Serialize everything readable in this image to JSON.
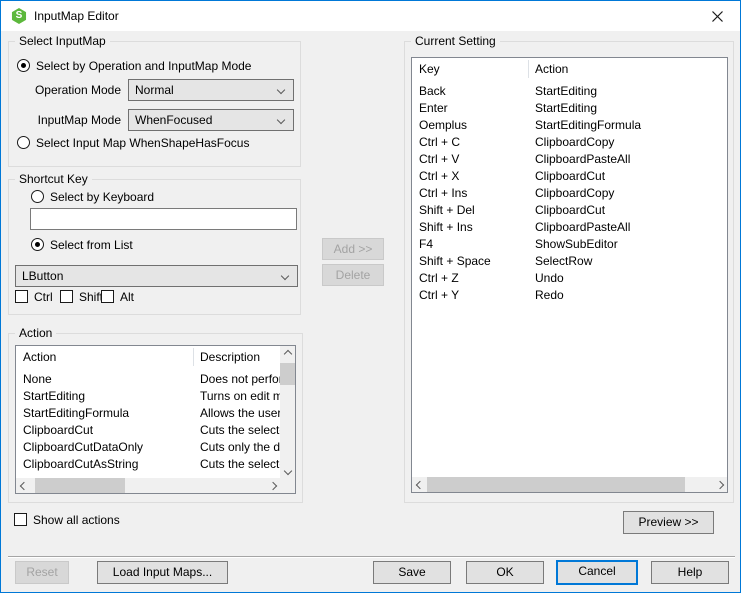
{
  "window": {
    "title": "InputMap Editor"
  },
  "colors": {
    "accent": "#0078d7",
    "icon_green": "#5cb83c",
    "disabled_text": "#a3a3a3"
  },
  "icons": {
    "app": "S"
  },
  "select_inputmap": {
    "title": "Select InputMap",
    "radio_operation_label": "Select by Operation and InputMap Mode",
    "radio_operation_selected": true,
    "operation_mode_label": "Operation Mode",
    "operation_mode_value": "Normal",
    "inputmap_mode_label": "InputMap Mode",
    "inputmap_mode_value": "WhenFocused",
    "radio_shape_label": "Select Input Map WhenShapeHasFocus",
    "radio_shape_selected": false
  },
  "shortcut_key": {
    "title": "Shortcut Key",
    "radio_keyboard_label": "Select by Keyboard",
    "keyboard_value": "",
    "radio_list_label": "Select from List",
    "radio_list_selected": true,
    "key_list_value": "LButton",
    "modifiers": [
      "Ctrl",
      "Shift",
      "Alt"
    ]
  },
  "action_list": {
    "title": "Action",
    "columns": [
      "Action",
      "Description"
    ],
    "rows": [
      [
        "None",
        "Does not perform"
      ],
      [
        "StartEditing",
        "Turns on edit mod"
      ],
      [
        "StartEditingFormula",
        "Allows the user to"
      ],
      [
        "ClipboardCut",
        "Cuts the selected"
      ],
      [
        "ClipboardCutDataOnly",
        "Cuts only the data"
      ],
      [
        "ClipboardCutAsString",
        "Cuts the selected"
      ]
    ]
  },
  "show_all_actions_label": "Show all actions",
  "middle_buttons": {
    "add": "Add >>",
    "delete": "Delete"
  },
  "current_setting": {
    "title": "Current Setting",
    "columns": [
      "Key",
      "Action"
    ],
    "rows": [
      [
        "Back",
        "StartEditing"
      ],
      [
        "Enter",
        "StartEditing"
      ],
      [
        "Oemplus",
        "StartEditingFormula"
      ],
      [
        "Ctrl + C",
        "ClipboardCopy"
      ],
      [
        "Ctrl + V",
        "ClipboardPasteAll"
      ],
      [
        "Ctrl + X",
        "ClipboardCut"
      ],
      [
        "Ctrl + Ins",
        "ClipboardCopy"
      ],
      [
        "Shift + Del",
        "ClipboardCut"
      ],
      [
        "Shift + Ins",
        "ClipboardPasteAll"
      ],
      [
        "F4",
        "ShowSubEditor"
      ],
      [
        "Shift + Space",
        "SelectRow"
      ],
      [
        "Ctrl + Z",
        "Undo"
      ],
      [
        "Ctrl + Y",
        "Redo"
      ]
    ]
  },
  "preview_button_label": "Preview >>",
  "bottom_buttons": {
    "reset": "Reset",
    "load": "Load Input Maps...",
    "save": "Save",
    "ok": "OK",
    "cancel": "Cancel",
    "help": "Help"
  }
}
